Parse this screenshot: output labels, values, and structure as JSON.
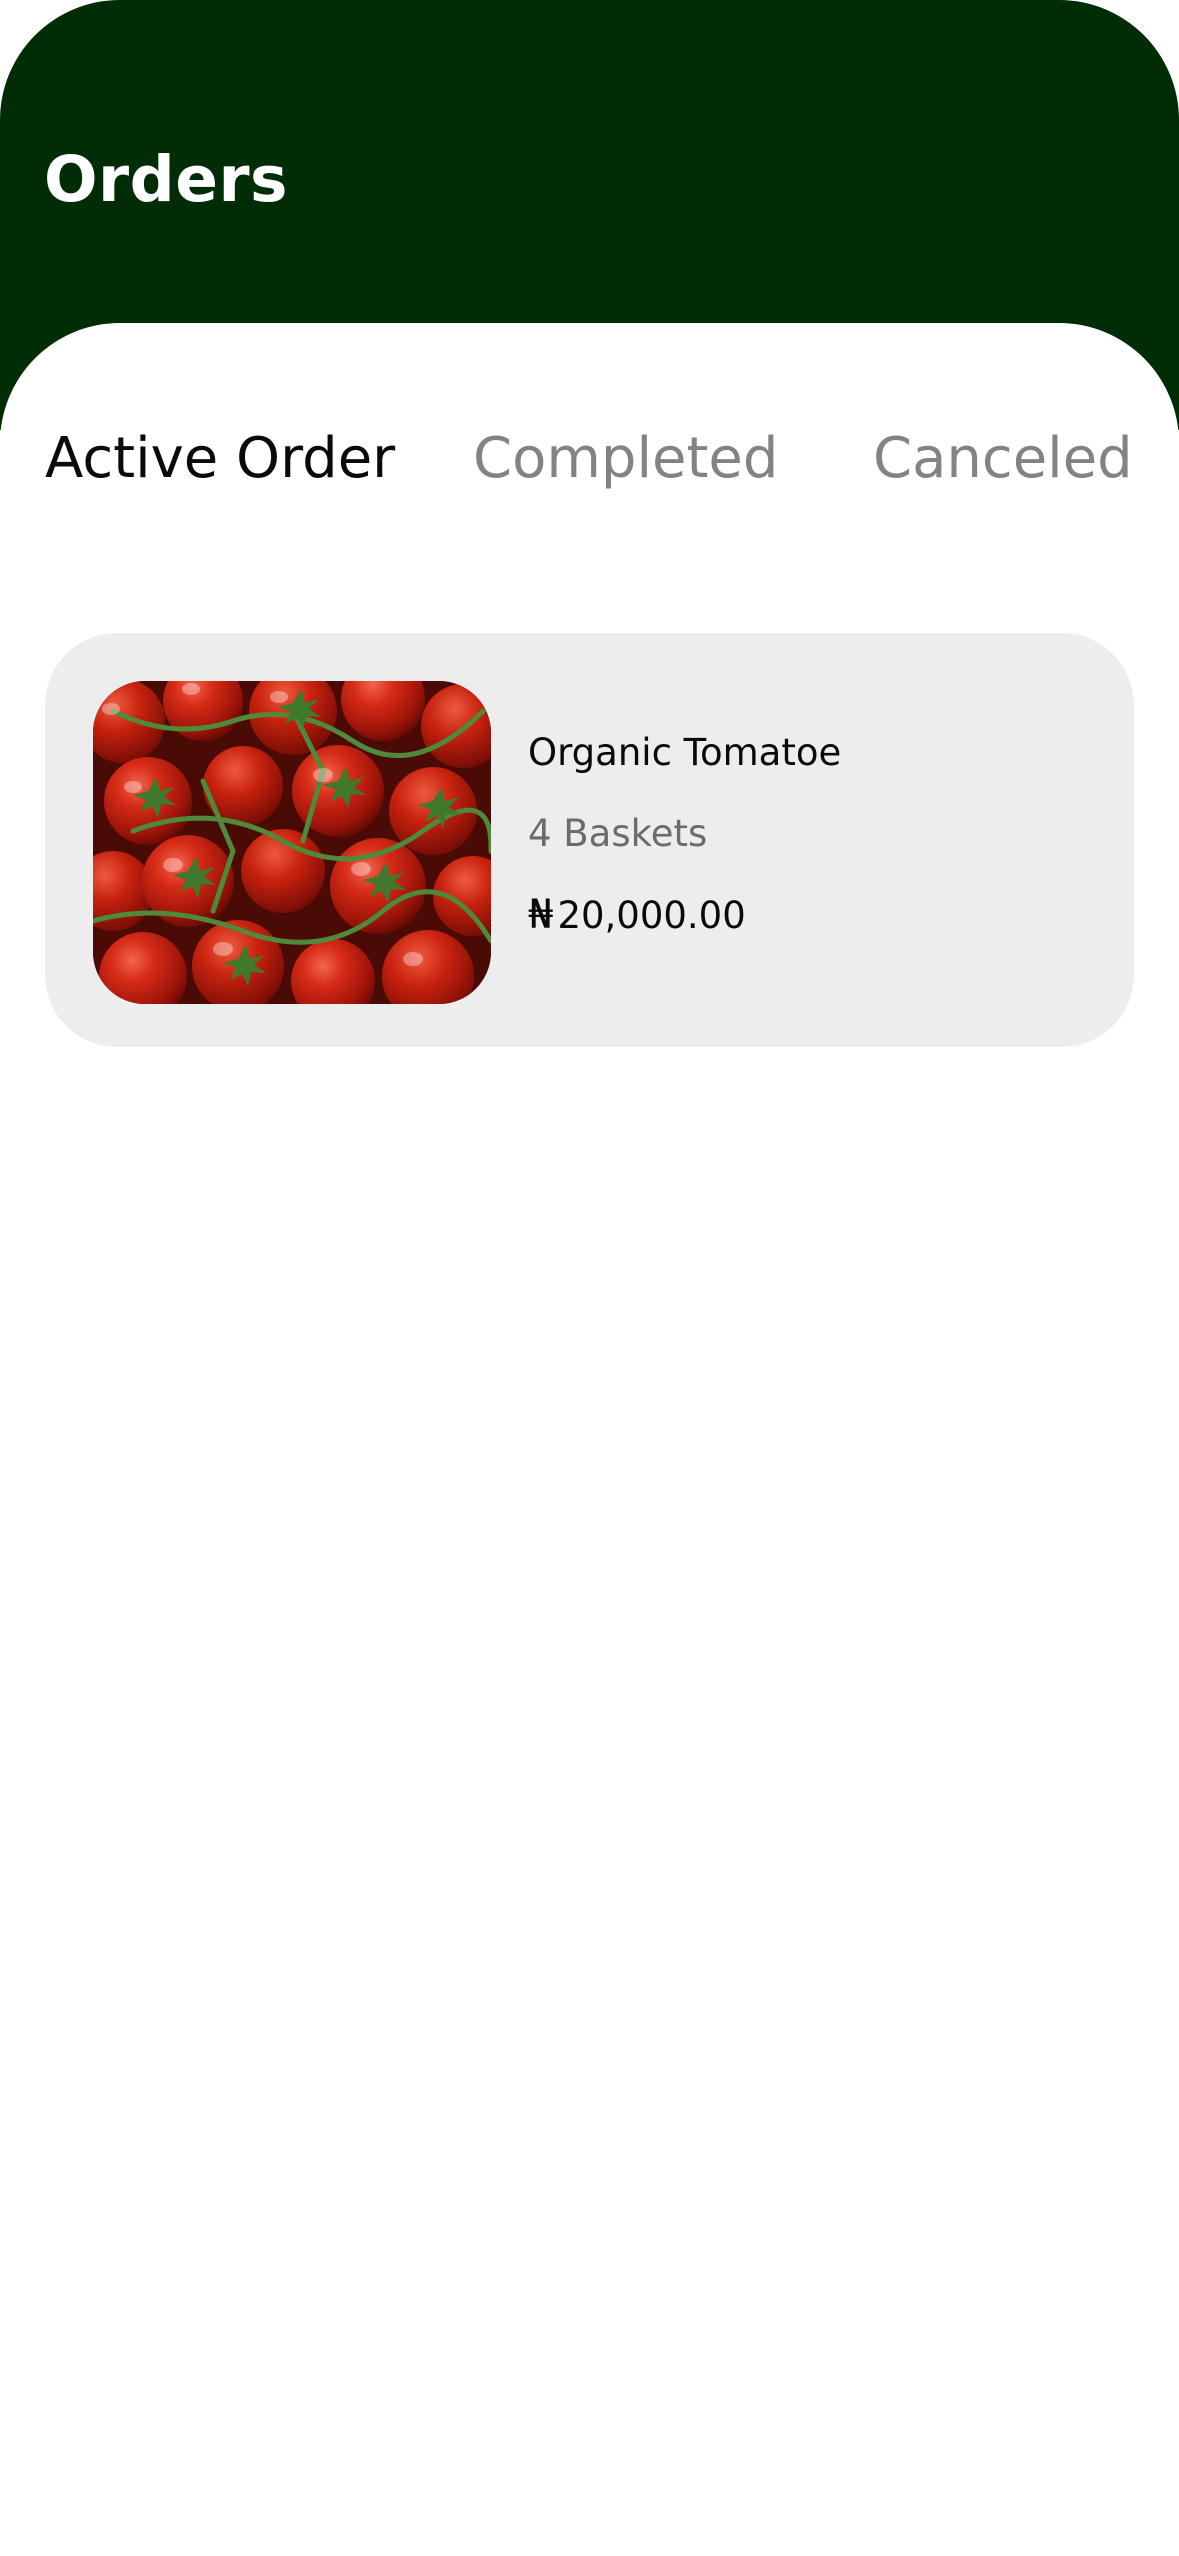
{
  "header": {
    "title": "Orders",
    "background_color": "#002d05"
  },
  "tabs": [
    {
      "label": "Active Order",
      "active": true
    },
    {
      "label": "Completed",
      "active": false
    },
    {
      "label": "Canceled",
      "active": false
    }
  ],
  "orders": [
    {
      "image": "tomatoes-photo",
      "name": "Organic Tomatoe",
      "quantity": "4 Baskets",
      "currency_symbol": "₦",
      "price": "20,000.00"
    }
  ],
  "colors": {
    "tab_active": "#0a0a0a",
    "tab_inactive": "#838383",
    "card_background": "#ededed"
  }
}
